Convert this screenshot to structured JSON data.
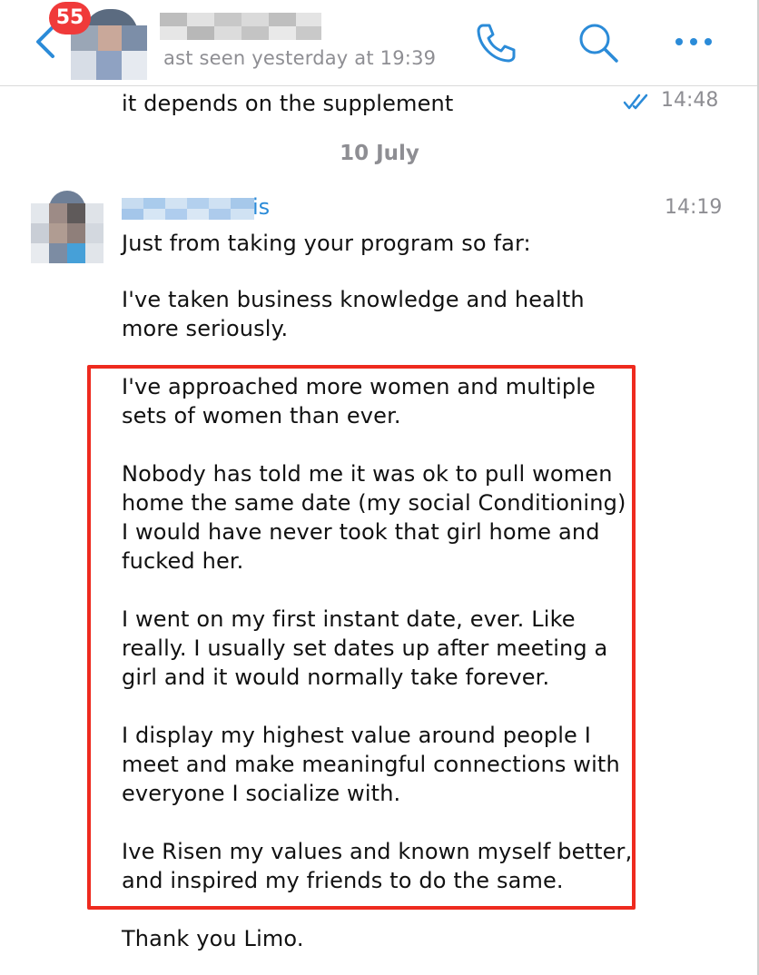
{
  "header": {
    "back_label": "<",
    "unread_badge": "55",
    "last_seen": "ast seen yesterday at 19:39",
    "icons": {
      "back": "chevron-left-icon",
      "call": "phone-icon",
      "search": "search-icon",
      "more": "more-horizontal-icon"
    }
  },
  "colors": {
    "accent": "#2b8bd8",
    "badge": "#f03a3a",
    "highlight_border": "#ee2a1e",
    "muted": "#8e8e93"
  },
  "messages": [
    {
      "text": "it depends on the supplement",
      "time": "14:48",
      "status": "read-double-check"
    }
  ],
  "date_separator": "10 July",
  "incoming": {
    "sender_suffix": "is",
    "time": "14:19",
    "paragraphs": [
      "Just from taking your program so far:",
      "I've taken business knowledge and health\nmore seriously.",
      "I've approached more women and multiple\nsets of women than ever.",
      "Nobody has told me it was ok to pull women\nhome the same date (my social Conditioning)\nI would have never took that girl home and\nfucked her.",
      "I went on my first instant date, ever. Like\nreally. I usually set dates up after meeting a\ngirl and it would normally take forever.",
      "I display my highest value around people I\nmeet and make meaningful connections with\neveryone I socialize with.",
      "Ive Risen my values and known myself better,\nand inspired my friends to do the same.",
      "Thank you Limo."
    ]
  }
}
